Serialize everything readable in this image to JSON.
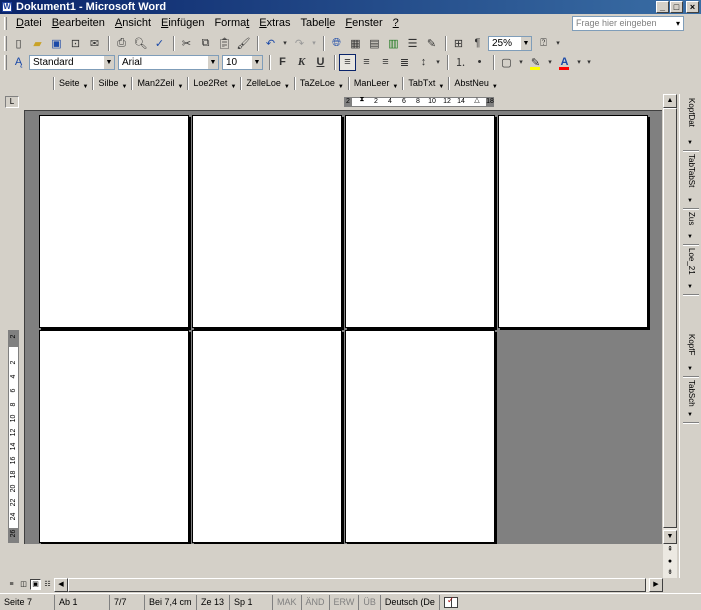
{
  "window": {
    "title": "Dokument1 - Microsoft Word",
    "app_icon": "W",
    "buttons": {
      "minimize": "_",
      "maximize": "□",
      "close": "×"
    }
  },
  "menu": {
    "items": [
      "Datei",
      "Bearbeiten",
      "Ansicht",
      "Einfügen",
      "Format",
      "Extras",
      "Tabelle",
      "Fenster",
      "?"
    ],
    "help_placeholder": "Frage hier eingeben",
    "help_arrow": "▾",
    "doc_buttons": {
      "minimize": "_",
      "restore": "❐",
      "close": "×"
    }
  },
  "standard_toolbar": {
    "zoom": "25%",
    "icons": [
      "new-document-icon",
      "open-folder-icon",
      "save-icon",
      "permission-icon",
      "email-icon",
      "print-icon",
      "print-preview-icon",
      "spelling-icon",
      "cut-icon",
      "copy-icon",
      "paste-icon",
      "format-painter-icon",
      "undo-icon",
      "redo-icon",
      "hyperlink-icon",
      "tables-borders-icon",
      "insert-table-icon",
      "insert-excel-icon",
      "columns-icon",
      "drawing-icon",
      "document-map-icon",
      "show-formatting-icon",
      "help-icon"
    ]
  },
  "formatting_toolbar": {
    "style": "Standard",
    "font": "Arial",
    "size": "10",
    "bold": "F",
    "italic": "K",
    "underline": "U",
    "font_color_letter": "A",
    "colors": {
      "highlight": "#ffff00",
      "font": "#ff0000"
    }
  },
  "custom_toolbar": {
    "buttons": [
      "Seite",
      "Silbe",
      "Man2Zeil",
      "Loe2Ret",
      "ZelleLoe",
      "TaZeLoe",
      "ManLeer",
      "TabTxt",
      "AbstNeu"
    ]
  },
  "ruler": {
    "corner": "L",
    "ticks": [
      "2",
      "2",
      "4",
      "6",
      "8",
      "10",
      "12",
      "14",
      "18"
    ],
    "vticks": [
      "2",
      "2",
      "4",
      "6",
      "8",
      "10",
      "12",
      "14",
      "16",
      "18",
      "20",
      "22",
      "24",
      "26"
    ]
  },
  "document": {
    "page_count": 7
  },
  "task_pane": {
    "items": [
      "KopfDat",
      "TabTabSt",
      "Zus",
      "Loe_21",
      "KopfF",
      "TabSch"
    ]
  },
  "statusbar": {
    "page": "Seite 7",
    "section": "Ab 1",
    "pages": "7/7",
    "position": "Bei 7,4 cm",
    "line": "Ze 13",
    "column": "Sp 1",
    "mak": "MAK",
    "aend": "ÄND",
    "erw": "ERW",
    "ub": "ÜB",
    "language": "Deutsch (De"
  }
}
